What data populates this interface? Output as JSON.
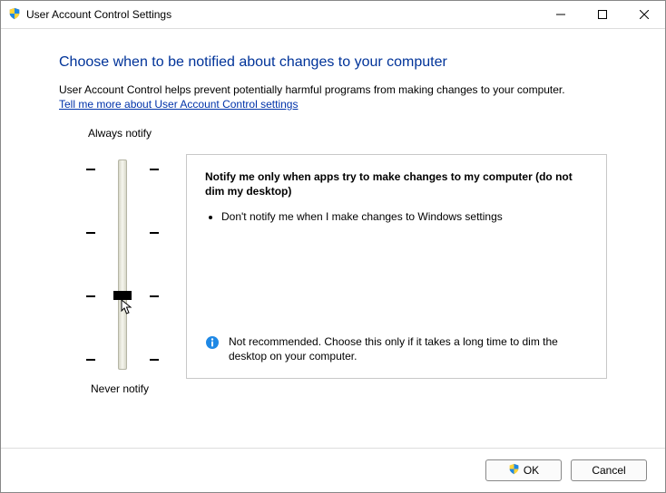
{
  "titlebar": {
    "title": "User Account Control Settings"
  },
  "main": {
    "heading": "Choose when to be notified about changes to your computer",
    "description": "User Account Control helps prevent potentially harmful programs from making changes to your computer.",
    "link": "Tell me more about User Account Control settings"
  },
  "slider": {
    "top_label": "Always notify",
    "bottom_label": "Never notify",
    "levels": 4,
    "selected_index": 2
  },
  "panel": {
    "title": "Notify me only when apps try to make changes to my computer (do not dim my desktop)",
    "bullets": [
      "Don't notify me when I make changes to Windows settings"
    ],
    "note": "Not recommended. Choose this only if it takes a long time to dim the desktop on your computer."
  },
  "footer": {
    "ok_label": "OK",
    "cancel_label": "Cancel"
  }
}
